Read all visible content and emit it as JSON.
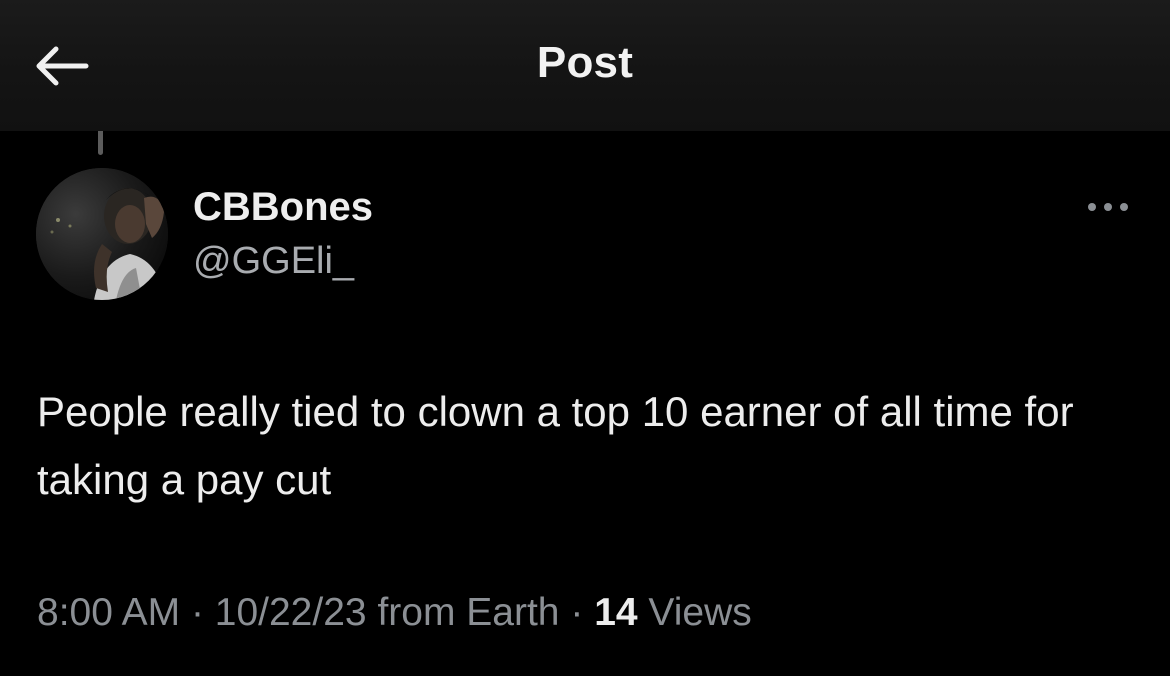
{
  "header": {
    "title": "Post",
    "back_icon": "arrow-left-icon"
  },
  "author": {
    "display_name": "CBBones",
    "handle": "@GGEli_",
    "avatar": "profile-photo"
  },
  "more_icon": "more-horizontal-icon",
  "post": {
    "text": "People really tied to clown a top 10 earner of all time for taking a pay cut"
  },
  "meta": {
    "time": "8:00 AM",
    "separator": "·",
    "date": "10/22/23",
    "source": "from Earth",
    "views_count": "14",
    "views_label": "Views"
  },
  "colors": {
    "background": "#000000",
    "header_background": "#141414",
    "primary_text": "#ededed",
    "secondary_text": "#8b8f94"
  }
}
